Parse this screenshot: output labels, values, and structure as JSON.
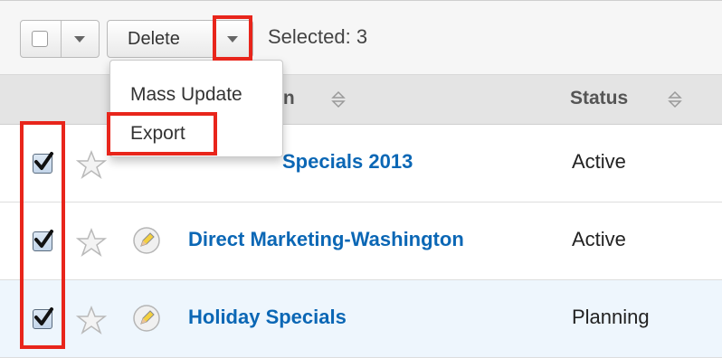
{
  "toolbar": {
    "delete_label": "Delete",
    "selected_label": "Selected:",
    "selected_count": "3"
  },
  "columns": {
    "campaign_partial": "gn",
    "status": "Status"
  },
  "actions_menu": {
    "items": [
      "Mass Update",
      "Export"
    ]
  },
  "rows": [
    {
      "name_visible": "Specials 2013",
      "status": "Active"
    },
    {
      "name": "Direct Marketing-Washington",
      "status": "Active"
    },
    {
      "name": "Holiday Specials",
      "status": "Planning"
    }
  ],
  "colors": {
    "link": "#0b67b5",
    "highlight_border": "#e8251b",
    "selected_row_bg": "#eef6fd",
    "header_bg": "#e4e4e4"
  },
  "icons": [
    "checkbox-icon",
    "caret-down-icon",
    "sort-icon",
    "star-icon",
    "edit-pencil-icon",
    "checkmark-icon"
  ]
}
